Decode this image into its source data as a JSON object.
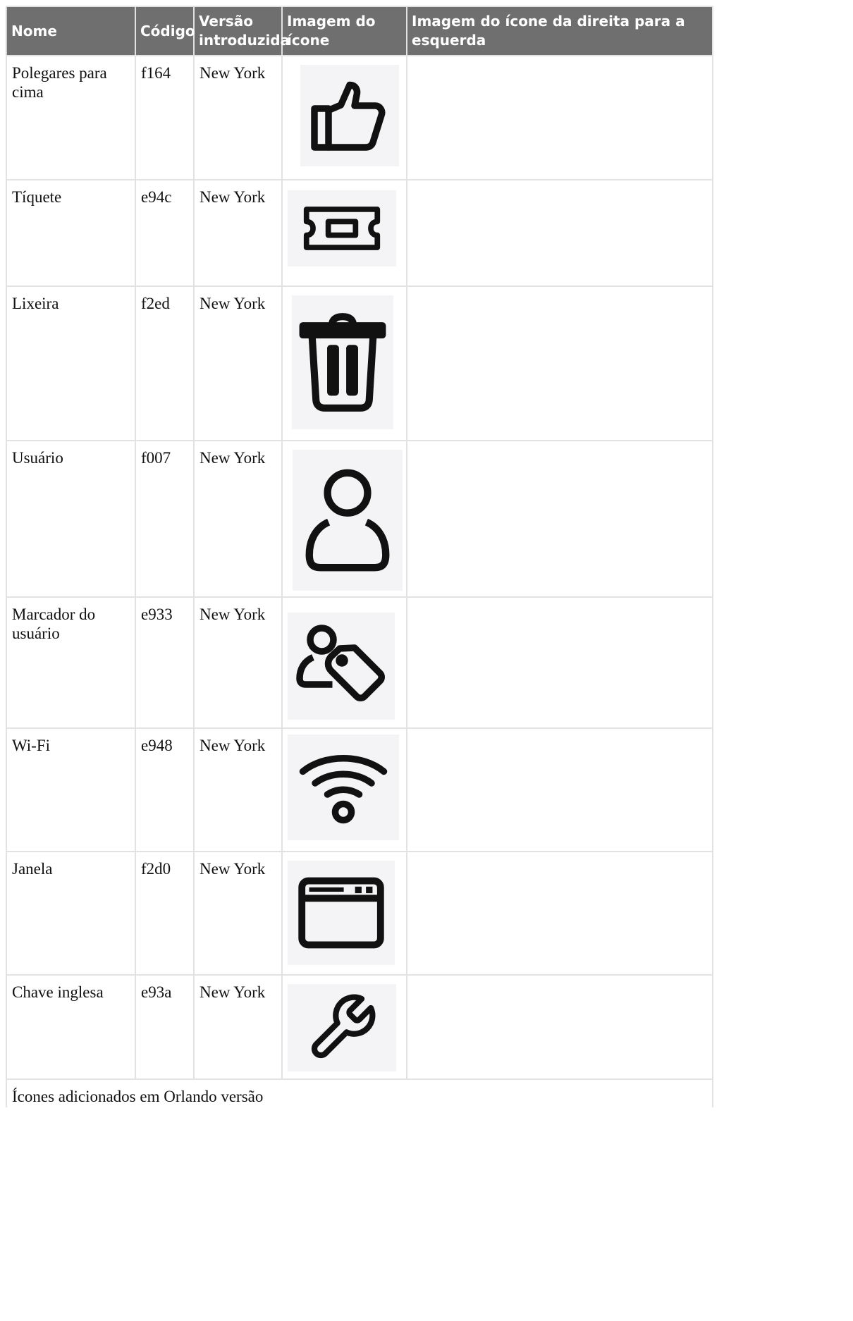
{
  "table": {
    "headers": [
      "Nome",
      "Código",
      "Versão introduzida",
      "Imagem do ícone",
      "Imagem do ícone da direita para a esquerda"
    ],
    "rows": [
      {
        "name": "Polegares para cima",
        "code": "f164",
        "version": "New York",
        "icon": "thumbs-up-icon",
        "rtl_icon": ""
      },
      {
        "name": "Tíquete",
        "code": "e94c",
        "version": "New York",
        "icon": "ticket-icon",
        "rtl_icon": ""
      },
      {
        "name": "Lixeira",
        "code": "f2ed",
        "version": "New York",
        "icon": "trash-icon",
        "rtl_icon": ""
      },
      {
        "name": "Usuário",
        "code": "f007",
        "version": "New York",
        "icon": "user-icon",
        "rtl_icon": ""
      },
      {
        "name": "Marcador do usuário",
        "code": "e933",
        "version": "New York",
        "icon": "user-tag-icon",
        "rtl_icon": ""
      },
      {
        "name": "Wi-Fi",
        "code": "e948",
        "version": "New York",
        "icon": "wifi-icon",
        "rtl_icon": ""
      },
      {
        "name": "Janela",
        "code": "f2d0",
        "version": "New York",
        "icon": "window-icon",
        "rtl_icon": ""
      },
      {
        "name": "Chave inglesa",
        "code": "e93a",
        "version": "New York",
        "icon": "wrench-icon",
        "rtl_icon": ""
      }
    ],
    "footer_text": "Ícones adicionados em Orlando versão"
  }
}
